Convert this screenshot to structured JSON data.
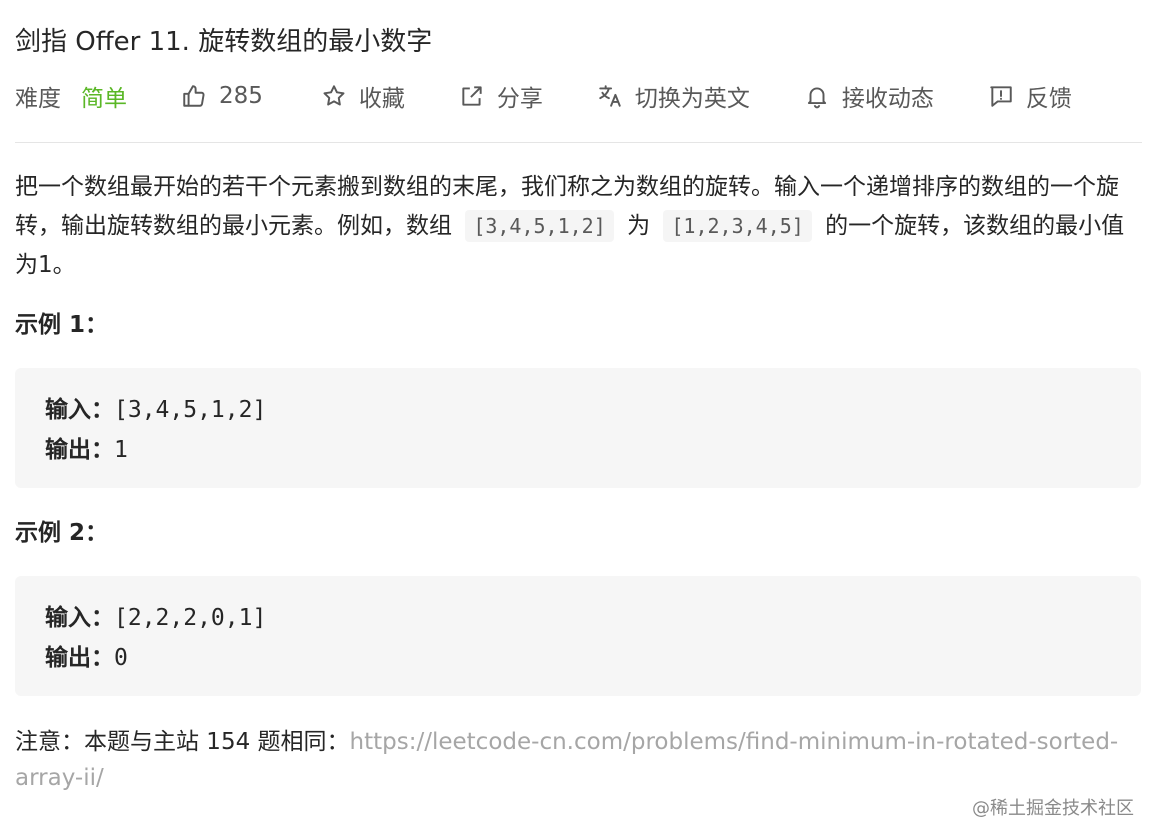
{
  "problem": {
    "title": "剑指 Offer 11. 旋转数组的最小数字"
  },
  "meta": {
    "difficulty_label": "难度",
    "difficulty_value": "简单",
    "likes": "285",
    "favorite": "收藏",
    "share": "分享",
    "translate": "切换为英文",
    "subscribe": "接收动态",
    "feedback": "反馈",
    "difficulty_color": "#5ab726"
  },
  "description": {
    "part1": "把一个数组最开始的若干个元素搬到数组的末尾，我们称之为数组的旋转。输入一个递增排序的数组的一个旋转，输出旋转数组的最小元素。例如，数组",
    "code1": "[3,4,5,1,2]",
    "part2": "为",
    "code2": "[1,2,3,4,5]",
    "part3": "的一个旋转，该数组的最小值为1。"
  },
  "examples": [
    {
      "title": "示例 1：",
      "input_label": "输入：",
      "input": "[3,4,5,1,2]",
      "output_label": "输出：",
      "output": "1"
    },
    {
      "title": "示例 2：",
      "input_label": "输入：",
      "input": "[2,2,2,0,1]",
      "output_label": "输出：",
      "output": "0"
    }
  ],
  "note": {
    "text": "注意：本题与主站 154 题相同：",
    "link": "https://leetcode-cn.com/problems/find-minimum-in-rotated-sorted-array-ii/"
  },
  "watermark": "@稀土掘金技术社区",
  "icons": [
    "thumbs-up-icon",
    "star-icon",
    "share-icon",
    "translate-icon",
    "bell-icon",
    "feedback-icon"
  ]
}
